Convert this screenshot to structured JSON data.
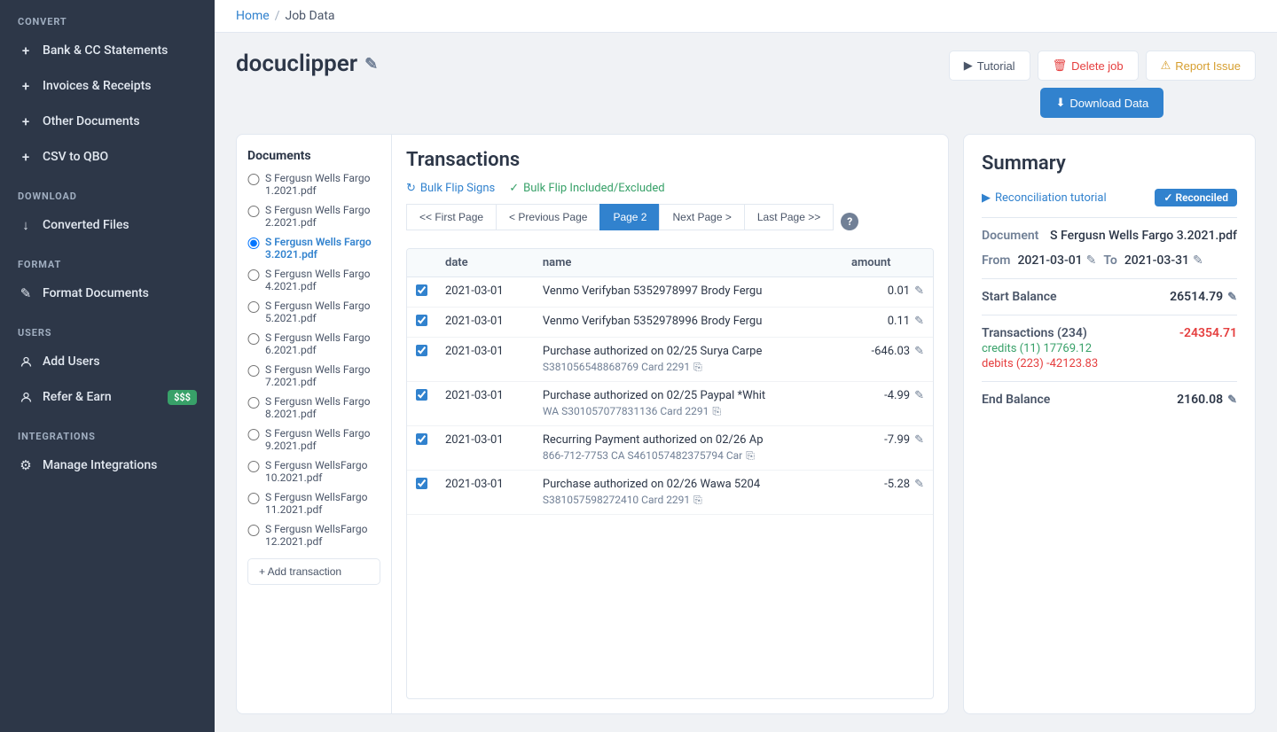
{
  "sidebar": {
    "convert_label": "CONVERT",
    "download_label": "DOWNLOAD",
    "format_label": "FORMAT",
    "users_label": "USERS",
    "integrations_label": "INTEGRATIONS",
    "items": [
      {
        "id": "bank-cc",
        "label": "Bank & CC Statements",
        "icon": "+"
      },
      {
        "id": "invoices",
        "label": "Invoices & Receipts",
        "icon": "+"
      },
      {
        "id": "other-docs",
        "label": "Other Documents",
        "icon": "+"
      },
      {
        "id": "csv-qbo",
        "label": "CSV to QBO",
        "icon": "+"
      },
      {
        "id": "converted-files",
        "label": "Converted Files",
        "icon": "↓"
      },
      {
        "id": "format-docs",
        "label": "Format Documents",
        "icon": "✎"
      },
      {
        "id": "add-users",
        "label": "Add Users",
        "icon": "👤"
      },
      {
        "id": "refer-earn",
        "label": "Refer & Earn",
        "icon": "$",
        "badge": "$$$"
      },
      {
        "id": "manage-integrations",
        "label": "Manage Integrations",
        "icon": "⚙"
      }
    ]
  },
  "breadcrumb": {
    "home": "Home",
    "separator": "/",
    "current": "Job Data"
  },
  "header": {
    "title": "docuclipper",
    "edit_icon": "✎",
    "tutorial_btn": "Tutorial",
    "delete_btn": "Delete job",
    "report_btn": "Report Issue",
    "download_btn": "Download Data"
  },
  "documents": {
    "title": "Documents",
    "items": [
      {
        "id": "doc1",
        "label": "S Fergusn Wells Fargo 1.2021.pdf",
        "active": false
      },
      {
        "id": "doc2",
        "label": "S Fergusn Wells Fargo 2.2021.pdf",
        "active": false
      },
      {
        "id": "doc3",
        "label": "S Fergusn Wells Fargo 3.2021.pdf",
        "active": true
      },
      {
        "id": "doc4",
        "label": "S Fergusn Wells Fargo 4.2021.pdf",
        "active": false
      },
      {
        "id": "doc5",
        "label": "S Fergusn Wells Fargo 5.2021.pdf",
        "active": false
      },
      {
        "id": "doc6",
        "label": "S Fergusn Wells Fargo 6.2021.pdf",
        "active": false
      },
      {
        "id": "doc7",
        "label": "S Fergusn Wells Fargo 7.2021.pdf",
        "active": false
      },
      {
        "id": "doc8",
        "label": "S Fergusn Wells Fargo 8.2021.pdf",
        "active": false
      },
      {
        "id": "doc9",
        "label": "S Fergusn Wells Fargo 9.2021.pdf",
        "active": false
      },
      {
        "id": "doc10",
        "label": "S Fergusn WellsFargo 10.2021.pdf",
        "active": false
      },
      {
        "id": "doc11",
        "label": "S Fergusn WellsFargo 11.2021.pdf",
        "active": false
      },
      {
        "id": "doc12",
        "label": "S Fergusn WellsFargo 12.2021.pdf",
        "active": false
      }
    ],
    "add_btn": "+ Add transaction"
  },
  "transactions": {
    "title": "Transactions",
    "bulk_flip_signs": "Bulk Flip Signs",
    "bulk_flip_included": "Bulk Flip Included/Excluded",
    "pagination": {
      "first": "<< First Page",
      "prev": "< Previous Page",
      "current": "Page 2",
      "next": "Next Page >",
      "last": "Last Page >>"
    },
    "table": {
      "headers": [
        "",
        "date",
        "name",
        "amount"
      ],
      "rows": [
        {
          "checked": true,
          "date": "2021-03-01",
          "name": "Venmo Verifyban 5352978997 Brody Fergu",
          "name2": "",
          "amount": "0.01",
          "negative": false
        },
        {
          "checked": true,
          "date": "2021-03-01",
          "name": "Venmo Verifyban 5352978996 Brody Fergu",
          "name2": "",
          "amount": "0.11",
          "negative": false
        },
        {
          "checked": true,
          "date": "2021-03-01",
          "name": "Purchase authorized on 02/25 Surya Carpe",
          "name2": "S381056548868769 Card 2291",
          "amount": "-646.03",
          "negative": true
        },
        {
          "checked": true,
          "date": "2021-03-01",
          "name": "Purchase authorized on 02/25 Paypal *Whit",
          "name2": "WA S301057077831136 Card 2291",
          "amount": "-4.99",
          "negative": true
        },
        {
          "checked": true,
          "date": "2021-03-01",
          "name": "Recurring Payment authorized on 02/26 Ap",
          "name2": "866-712-7753 CA S461057482375794 Car",
          "amount": "-7.99",
          "negative": true
        },
        {
          "checked": true,
          "date": "2021-03-01",
          "name": "Purchase authorized on 02/26 Wawa 5204",
          "name2": "S381057598272410 Card 2291",
          "amount": "-5.28",
          "negative": true
        }
      ]
    }
  },
  "summary": {
    "title": "Summary",
    "reconciliation_link": "Reconciliation tutorial",
    "reconciled_badge": "✓ Reconciled",
    "document_label": "Document",
    "document_value": "S Fergusn Wells Fargo 3.2021.pdf",
    "from_label": "From",
    "from_value": "2021-03-01",
    "to_label": "To",
    "to_value": "2021-03-31",
    "start_balance_label": "Start Balance",
    "start_balance_value": "26514.79",
    "transactions_label": "Transactions (234)",
    "transactions_value": "-24354.71",
    "credits_label": "credits (11) 17769.12",
    "debits_label": "debits (223) -42123.83",
    "end_balance_label": "End Balance",
    "end_balance_value": "2160.08"
  }
}
